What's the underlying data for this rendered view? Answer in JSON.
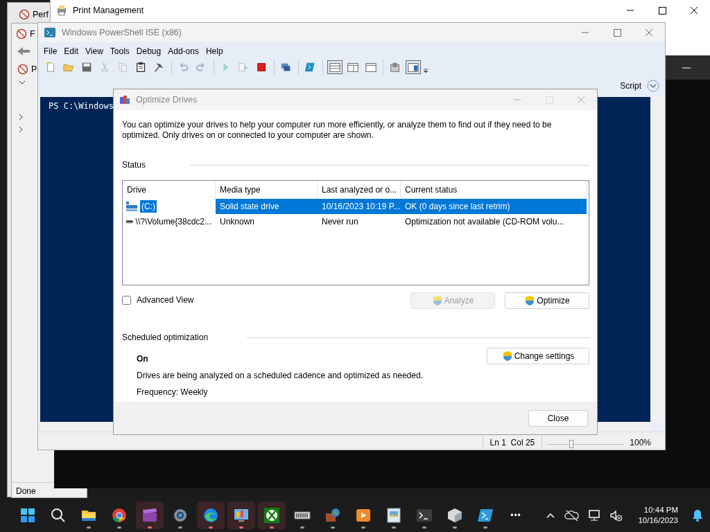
{
  "perf_window": {
    "title": "Perf"
  },
  "f_window": {
    "title": "F",
    "tree_item": "P",
    "status": "Done"
  },
  "print_management": {
    "title": "Print Management"
  },
  "ise": {
    "title": "Windows PowerShell ISE (x86)",
    "menu": [
      "File",
      "Edit",
      "View",
      "Tools",
      "Debug",
      "Add-ons",
      "Help"
    ],
    "toolbar": [
      {
        "kind": "new",
        "disabled": false,
        "pressed": false
      },
      {
        "kind": "open",
        "disabled": false,
        "pressed": false
      },
      {
        "kind": "save",
        "disabled": false,
        "pressed": false
      },
      {
        "kind": "cut",
        "disabled": true,
        "pressed": false
      },
      {
        "kind": "copy",
        "disabled": true,
        "pressed": false
      },
      {
        "kind": "paste",
        "disabled": false,
        "pressed": false
      },
      {
        "kind": "clear",
        "disabled": false,
        "pressed": false
      },
      {
        "kind": "sep"
      },
      {
        "kind": "undo",
        "disabled": true,
        "pressed": false
      },
      {
        "kind": "redo",
        "disabled": true,
        "pressed": false
      },
      {
        "kind": "sep"
      },
      {
        "kind": "run",
        "disabled": true,
        "pressed": false
      },
      {
        "kind": "runsel",
        "disabled": true,
        "pressed": false
      },
      {
        "kind": "stop",
        "disabled": false,
        "pressed": false
      },
      {
        "kind": "sep"
      },
      {
        "kind": "remote",
        "disabled": false,
        "pressed": false
      },
      {
        "kind": "sep"
      },
      {
        "kind": "console",
        "disabled": false,
        "pressed": false
      },
      {
        "kind": "sep"
      },
      {
        "kind": "paneTop",
        "disabled": false,
        "pressed": true
      },
      {
        "kind": "paneRight",
        "disabled": false,
        "pressed": false
      },
      {
        "kind": "paneMax",
        "disabled": false,
        "pressed": false
      },
      {
        "kind": "sep"
      },
      {
        "kind": "snippet",
        "disabled": false,
        "pressed": false
      },
      {
        "kind": "commands",
        "disabled": false,
        "pressed": true
      }
    ],
    "pane_label": "Script",
    "console_prompt": "PS C:\\Windows",
    "position": "Ln 1  Col 25",
    "zoom_slider": {
      "level": 0.3
    },
    "zoom": "100%"
  },
  "dialog": {
    "title": "Optimize Drives",
    "intro": "You can optimize your drives to help your computer run more efficiently, or analyze them to find out if they need to be optimized. Only drives on or connected to your computer are shown.",
    "status_heading": "Status",
    "columns": [
      "Drive",
      "Media type",
      "Last analyzed or o...",
      "Current status"
    ],
    "rows": [
      {
        "kind": "ssd",
        "drive": "(C:)",
        "media_type": "Solid state drive",
        "last_analyzed": "10/16/2023 10:19 P...",
        "current_status": "OK (0 days since last retrim)",
        "selected": true
      },
      {
        "kind": "optical",
        "drive": "\\\\?\\Volume{38cdc2...",
        "media_type": "Unknown",
        "last_analyzed": "Never run",
        "current_status": "Optimization not available (CD-ROM volu...",
        "selected": false
      }
    ],
    "advanced_view": {
      "label": "Advanced View",
      "checked": false
    },
    "actions": [
      {
        "label": "Analyze",
        "disabled": true
      },
      {
        "label": "Optimize",
        "disabled": false
      }
    ],
    "scheduled": {
      "heading": "Scheduled optimization",
      "state": "On",
      "description": "Drives are being analyzed on a scheduled cadence and optimized as needed.",
      "frequency": "Frequency: Weekly",
      "button": "Change settings"
    },
    "close_button": "Close"
  },
  "taskbar": {
    "apps": [
      {
        "kind": "start",
        "highlighted": false,
        "running": false
      },
      {
        "kind": "search",
        "highlighted": false,
        "running": false
      },
      {
        "kind": "folder",
        "highlighted": false,
        "running": true
      },
      {
        "kind": "browser",
        "highlighted": false,
        "running": true
      },
      {
        "kind": "clapper",
        "highlighted": true,
        "running": true
      },
      {
        "kind": "gear",
        "highlighted": false,
        "running": true
      },
      {
        "kind": "edge",
        "highlighted": true,
        "running": true
      },
      {
        "kind": "panel",
        "highlighted": true,
        "running": true
      },
      {
        "kind": "xbox",
        "highlighted": true,
        "running": true
      },
      {
        "kind": "chip",
        "highlighted": false,
        "running": true
      },
      {
        "kind": "globe",
        "highlighted": false,
        "running": true
      },
      {
        "kind": "player",
        "highlighted": false,
        "running": true
      },
      {
        "kind": "picture",
        "highlighted": false,
        "running": true
      },
      {
        "kind": "terminal",
        "highlighted": false,
        "running": true
      },
      {
        "kind": "cube",
        "highlighted": false,
        "running": true
      },
      {
        "kind": "shell",
        "highlighted": false,
        "running": true
      }
    ],
    "more": "•••",
    "clock": {
      "time": "10:44 PM",
      "date": "10/16/2023"
    }
  }
}
